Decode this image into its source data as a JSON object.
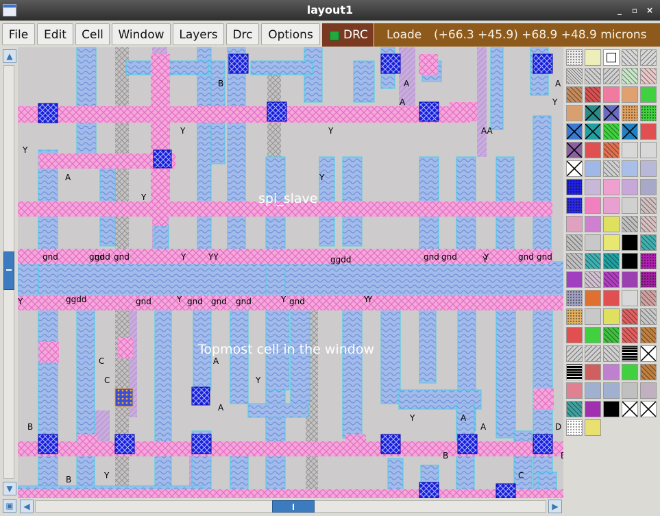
{
  "window": {
    "title": "layout1",
    "minimize": "_",
    "restore": "▫",
    "close": "×"
  },
  "menu": [
    {
      "name": "menu-file",
      "label": "File"
    },
    {
      "name": "menu-edit",
      "label": "Edit"
    },
    {
      "name": "menu-cell",
      "label": "Cell"
    },
    {
      "name": "menu-window",
      "label": "Window"
    },
    {
      "name": "menu-layers",
      "label": "Layers"
    },
    {
      "name": "menu-drc",
      "label": "Drc"
    },
    {
      "name": "menu-options",
      "label": "Options"
    }
  ],
  "drc_indicator": {
    "label": "DRC",
    "status_color": "#22a83c"
  },
  "status": {
    "text": "Loade",
    "coords": "(+66.3 +45.9) +68.9 +48.9 microns"
  },
  "canvas": {
    "cell_name": "spi_slave",
    "overlay_note": "Topmost cell in the window",
    "labels": [
      "B",
      "A",
      "A",
      "A",
      "Y",
      "Y",
      "Y",
      "AA",
      "Y",
      "A",
      "Y",
      "Y",
      "gnd",
      "gnd",
      "gnd",
      "gnd",
      "gnd",
      "gnd",
      "gnd",
      "gnd",
      "gnd",
      "gnd",
      "gnd",
      "gnd",
      "gnd",
      "Y",
      "YY",
      "ggdd",
      "Y",
      "Y",
      "ggdd",
      "Y",
      "Y",
      "Y",
      "Y",
      "C",
      "C",
      "A",
      "Y",
      "A",
      "B",
      "B",
      "Y",
      "A",
      "A",
      "D",
      "D",
      "B",
      "Y",
      "C",
      "Y"
    ]
  },
  "icons": {
    "scroll_up": "up-arrow-icon",
    "scroll_down": "down-arrow-icon",
    "scroll_left": "left-arrow-icon",
    "scroll_right": "right-arrow-icon",
    "corner": "zoom-box-icon"
  },
  "palette": {
    "rows": 21,
    "columns": 5
  }
}
